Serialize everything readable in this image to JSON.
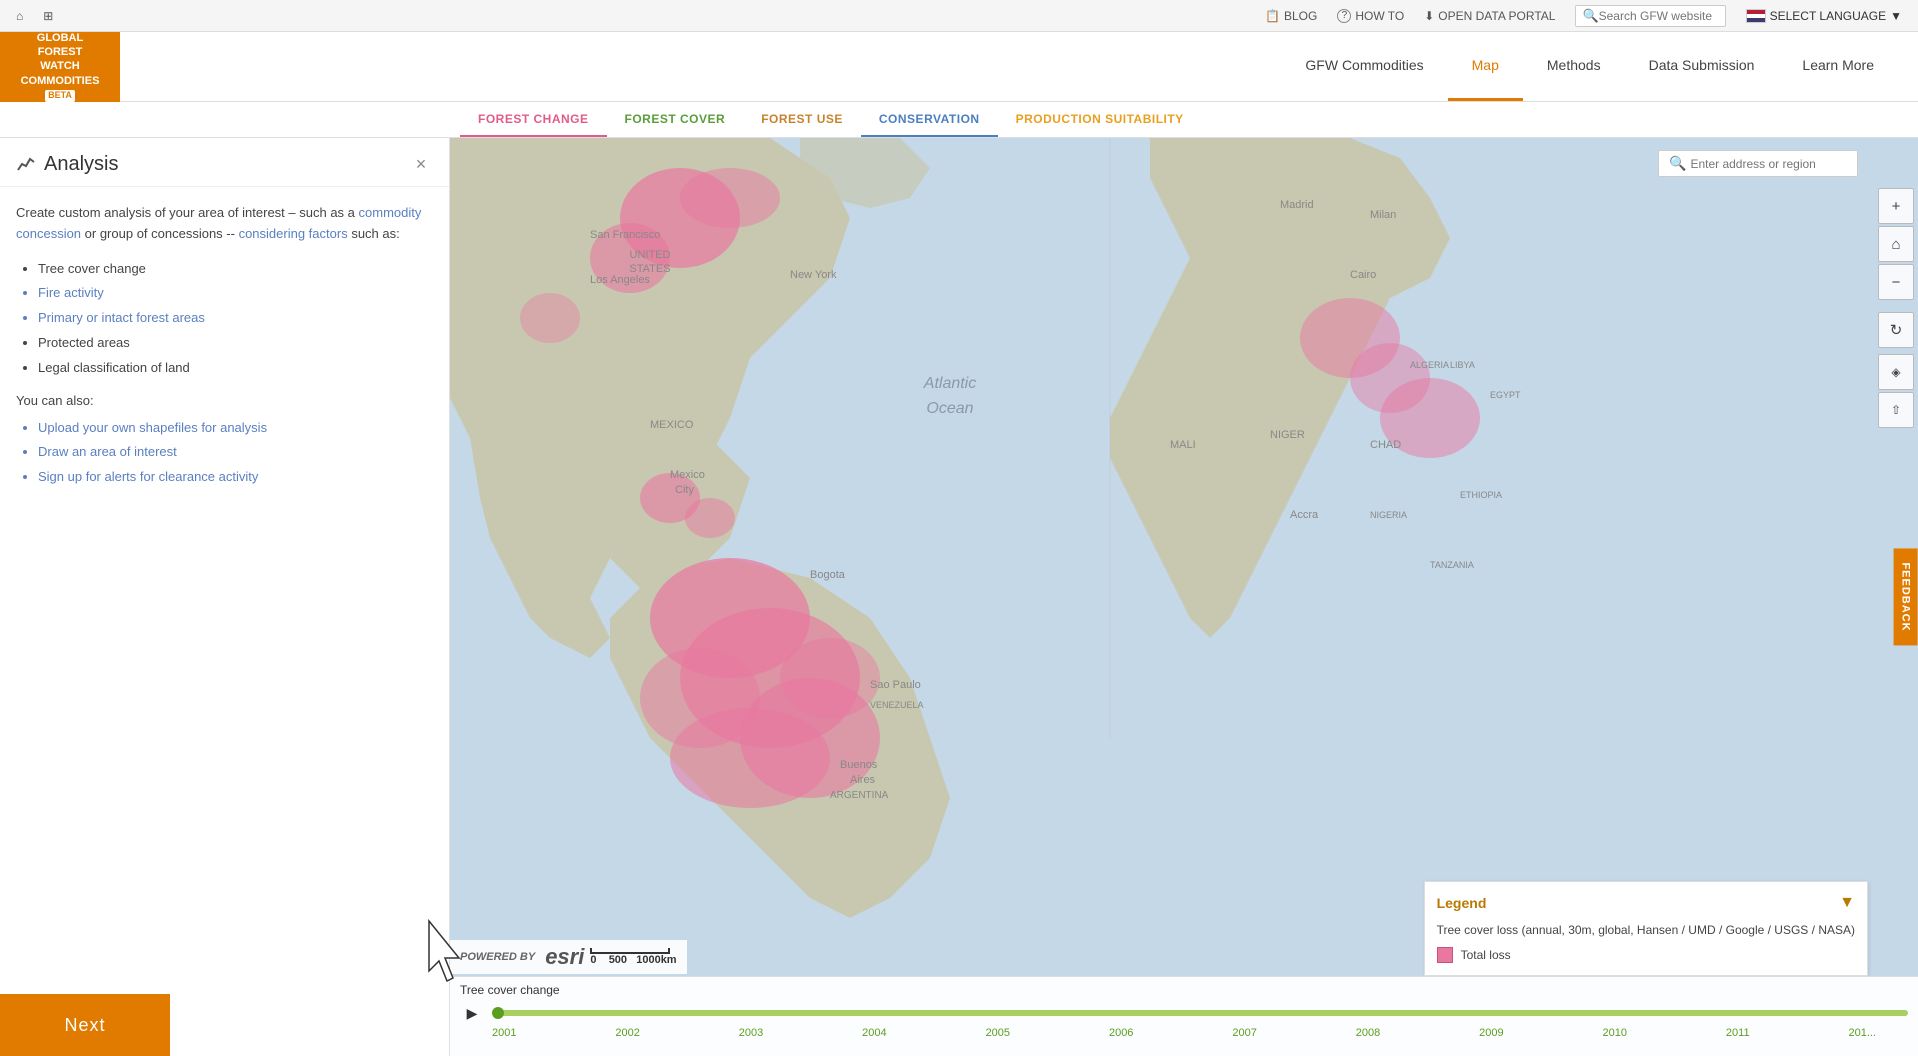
{
  "app": {
    "logo": {
      "line1": "GLOBAL",
      "line2": "FOREST",
      "line3": "WATCH",
      "line4": "COMMODITIES",
      "beta": "BETA"
    }
  },
  "topbar": {
    "blog_label": "BLOG",
    "howto_label": "HOW TO",
    "opendata_label": "OPEN DATA PORTAL",
    "search_placeholder": "Search GFW website",
    "language_label": "SELECT LANGUAGE"
  },
  "mainnav": {
    "items": [
      {
        "label": "GFW Commodities",
        "active": false
      },
      {
        "label": "Map",
        "active": true
      },
      {
        "label": "Methods",
        "active": false
      },
      {
        "label": "Data Submission",
        "active": false
      },
      {
        "label": "Learn More",
        "active": false
      }
    ]
  },
  "maptabs": {
    "items": [
      {
        "label": "FOREST CHANGE",
        "class": "forest-change",
        "active": true
      },
      {
        "label": "FOREST COVER",
        "class": "forest-cover",
        "active": false
      },
      {
        "label": "FOREST USE",
        "class": "forest-use",
        "active": false
      },
      {
        "label": "CONSERVATION",
        "class": "conservation",
        "active": false
      },
      {
        "label": "PRODUCTION SUITABILITY",
        "class": "production",
        "active": false
      }
    ]
  },
  "sidebar": {
    "title": "Analysis",
    "intro": "Create custom analysis of your area of interest – such as a commodity concession or group of concessions -- considering factors such as:",
    "factors": [
      {
        "label": "Tree cover change",
        "highlight": false
      },
      {
        "label": "Fire activity",
        "highlight": true
      },
      {
        "label": "Primary or intact forest areas",
        "highlight": true
      },
      {
        "label": "Protected areas",
        "highlight": false
      },
      {
        "label": "Legal classification of land",
        "highlight": false
      }
    ],
    "also_label": "You can also:",
    "actions": [
      {
        "label": "Upload your own shapefiles for analysis"
      },
      {
        "label": "Draw an area of interest"
      },
      {
        "label": "Sign up for alerts for clearance activity"
      }
    ],
    "next_button": "Next"
  },
  "map": {
    "search_placeholder": "Enter address or region",
    "timeline_label": "Tree cover change",
    "years": [
      "2001",
      "2002",
      "2003",
      "2004",
      "2005",
      "2006",
      "2007",
      "2008",
      "2009",
      "2010",
      "2011",
      "201..."
    ]
  },
  "legend": {
    "title": "Legend",
    "layer_name": "Tree cover loss (annual, 30m, global, Hansen / UMD / Google / USGS / NASA)",
    "items": [
      {
        "label": "Total loss",
        "color": "#e878a0"
      }
    ]
  },
  "esri": {
    "label": "esri",
    "scale": "500",
    "scale_unit": "1000km"
  },
  "feedback": {
    "label": "FEEDBACK"
  },
  "icons": {
    "home": "⌂",
    "grid": "⊞",
    "blog": "📋",
    "howto": "?",
    "opendata": "⬇",
    "search": "🔍",
    "plus": "+",
    "minus": "−",
    "layers": "◈",
    "share": "⇧",
    "zoom_in": "+",
    "zoom_out": "−",
    "home_map": "⌂",
    "refresh": "↻",
    "chevron_down": "▼",
    "play": "▶",
    "close": "×",
    "chart": "📈"
  }
}
